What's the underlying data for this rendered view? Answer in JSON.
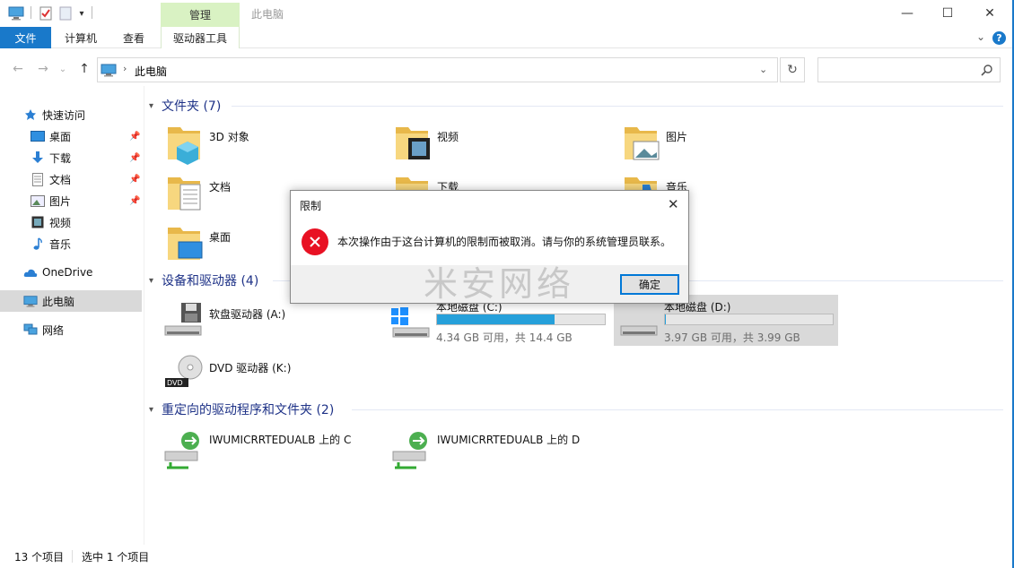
{
  "window": {
    "title": "此电脑",
    "context_tab": "管理",
    "minimize": "—",
    "maximize": "☐",
    "close": "✕"
  },
  "ribbon": {
    "tabs": [
      "文件",
      "计算机",
      "查看",
      "驱动器工具"
    ],
    "expand": "⌄",
    "help": "?"
  },
  "address": {
    "back": "←",
    "forward": "→",
    "recent": "⌄",
    "up": "↑",
    "separator": "›",
    "location": "此电脑",
    "dropdown": "⌄",
    "refresh": "↻",
    "search_value": "",
    "search_placeholder": ""
  },
  "nav": {
    "quick_access": "快速访问",
    "items": [
      {
        "label": "桌面",
        "pinned": true
      },
      {
        "label": "下载",
        "pinned": true
      },
      {
        "label": "文档",
        "pinned": true
      },
      {
        "label": "图片",
        "pinned": true
      },
      {
        "label": "视频",
        "pinned": false
      },
      {
        "label": "音乐",
        "pinned": false
      }
    ],
    "onedrive": "OneDrive",
    "this_pc": "此电脑",
    "network": "网络"
  },
  "groups": {
    "folders": "文件夹 (7)",
    "devices": "设备和驱动器 (4)",
    "redirected": "重定向的驱动程序和文件夹 (2)"
  },
  "folders": [
    "3D 对象",
    "视频",
    "图片",
    "文档",
    "下载",
    "音乐",
    "桌面"
  ],
  "drives": [
    {
      "name": "软盘驱动器 (A:)"
    },
    {
      "name": "本地磁盘 (C:)",
      "info": "4.34 GB 可用，共 14.4 GB",
      "used_fraction": 0.7
    },
    {
      "name": "本地磁盘 (D:)",
      "info": "3.97 GB 可用，共 3.99 GB",
      "used_fraction": 0.005
    },
    {
      "name": "DVD 驱动器 (K:)"
    }
  ],
  "redirected": [
    "IWUMICRRTEDUALB 上的 C",
    "IWUMICRRTEDUALB 上的 D"
  ],
  "status": {
    "count": "13 个项目",
    "selected": "选中 1 个项目"
  },
  "dialog": {
    "title": "限制",
    "message": "本次操作由于这台计算机的限制而被取消。请与你的系统管理员联系。",
    "ok": "确定",
    "close": "✕"
  },
  "watermark": "米安网络",
  "colors": {
    "accent": "#1979ca",
    "progress": "#26a0da",
    "error": "#e81123",
    "context_tab": "#d9f2c3"
  }
}
